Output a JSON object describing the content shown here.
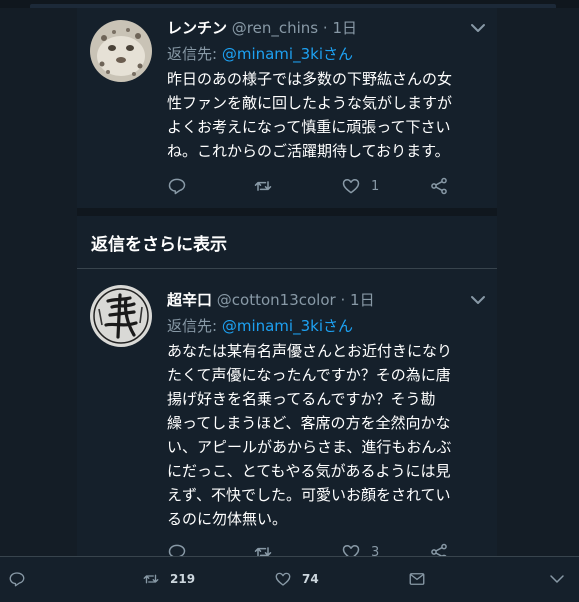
{
  "tweets": [
    {
      "name": "レンチン",
      "handle": "@ren_chins",
      "dot": "·",
      "time": "1日",
      "reply_prefix": "返信先: ",
      "reply_to": "@minami_3kiさん",
      "body": "昨日のあの様子では多数の下野紘さんの女\n性ファンを敵に回したような気がしますが\nよくお考えになって慎重に頑張って下さい\nね。これからのご活躍期待しております。",
      "reply_count": "",
      "retweet_count": "",
      "like_count": "1",
      "avatar": "snow-leopard-avatar"
    },
    {
      "name": "超辛口",
      "handle": "@cotton13color",
      "dot": "·",
      "time": "1日",
      "reply_prefix": "返信先: ",
      "reply_to": "@minami_3kiさん",
      "body": "あなたは某有名声優さんとお近付きになり\nたくて声優になったんですか？その為に唐\n揚げ好きを名乗ってるんですか？そう勘\n繰ってしまうほど、客席の方を全然向かな\nい、アピールがあからさま、進行もおんぶ\nにだっこ、とてもやる気があるようには見\nえず、不快でした。可愛いお顔をされてい\nるのに勿体無い。",
      "reply_count": "",
      "retweet_count": "",
      "like_count": "3",
      "avatar": "calligraphy-avatar"
    }
  ],
  "show_more_label": "返信をさらに表示",
  "bottom_bar": {
    "retweet_count": "219",
    "like_count": "74"
  },
  "colors": {
    "background": "#141d26",
    "panel": "#15202b",
    "link": "#1da1f2",
    "muted": "#8899a6"
  }
}
